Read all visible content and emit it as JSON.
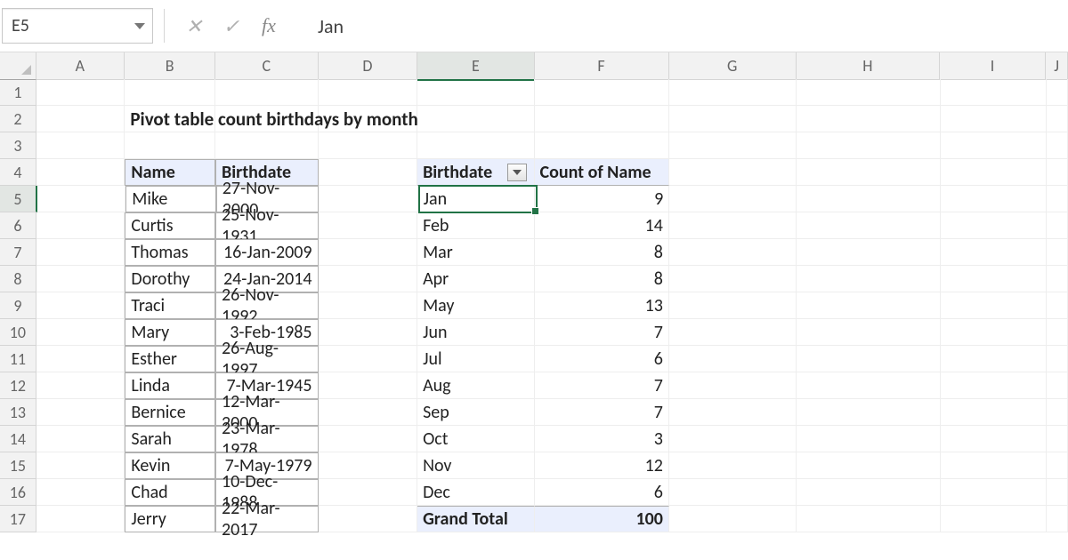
{
  "formula_bar": {
    "name_box": "E5",
    "cancel_label": "✕",
    "accept_label": "✓",
    "fx_label": "fx",
    "formula_value": "Jan"
  },
  "columns": [
    "A",
    "B",
    "C",
    "D",
    "E",
    "F",
    "G",
    "H",
    "I",
    "J"
  ],
  "row_headers": [
    "1",
    "2",
    "3",
    "4",
    "5",
    "6",
    "7",
    "8",
    "9",
    "10",
    "11",
    "12",
    "13",
    "14",
    "15",
    "16",
    "17"
  ],
  "active": {
    "col": "E",
    "row": "5"
  },
  "heading": "Pivot table count birthdays by month",
  "source_table": {
    "headers": {
      "name": "Name",
      "birthdate": "Birthdate"
    },
    "rows": [
      {
        "name": "Mike",
        "birthdate": "27-Nov-2000"
      },
      {
        "name": "Curtis",
        "birthdate": "25-Nov-1931"
      },
      {
        "name": "Thomas",
        "birthdate": "16-Jan-2009"
      },
      {
        "name": "Dorothy",
        "birthdate": "24-Jan-2014"
      },
      {
        "name": "Traci",
        "birthdate": "26-Nov-1992"
      },
      {
        "name": "Mary",
        "birthdate": "3-Feb-1985"
      },
      {
        "name": "Esther",
        "birthdate": "26-Aug-1997"
      },
      {
        "name": "Linda",
        "birthdate": "7-Mar-1945"
      },
      {
        "name": "Bernice",
        "birthdate": "12-Mar-2000"
      },
      {
        "name": "Sarah",
        "birthdate": "23-Mar-1978"
      },
      {
        "name": "Kevin",
        "birthdate": "7-May-1979"
      },
      {
        "name": "Chad",
        "birthdate": "10-Dec-1988"
      },
      {
        "name": "Jerry",
        "birthdate": "22-Mar-2017"
      }
    ]
  },
  "pivot_table": {
    "header_left": "Birthdate",
    "header_right": "Count of Name",
    "rows": [
      {
        "label": "Jan",
        "value": "9"
      },
      {
        "label": "Feb",
        "value": "14"
      },
      {
        "label": "Mar",
        "value": "8"
      },
      {
        "label": "Apr",
        "value": "8"
      },
      {
        "label": "May",
        "value": "13"
      },
      {
        "label": "Jun",
        "value": "7"
      },
      {
        "label": "Jul",
        "value": "6"
      },
      {
        "label": "Aug",
        "value": "7"
      },
      {
        "label": "Sep",
        "value": "7"
      },
      {
        "label": "Oct",
        "value": "3"
      },
      {
        "label": "Nov",
        "value": "12"
      },
      {
        "label": "Dec",
        "value": "6"
      }
    ],
    "total_label": "Grand Total",
    "total_value": "100"
  }
}
